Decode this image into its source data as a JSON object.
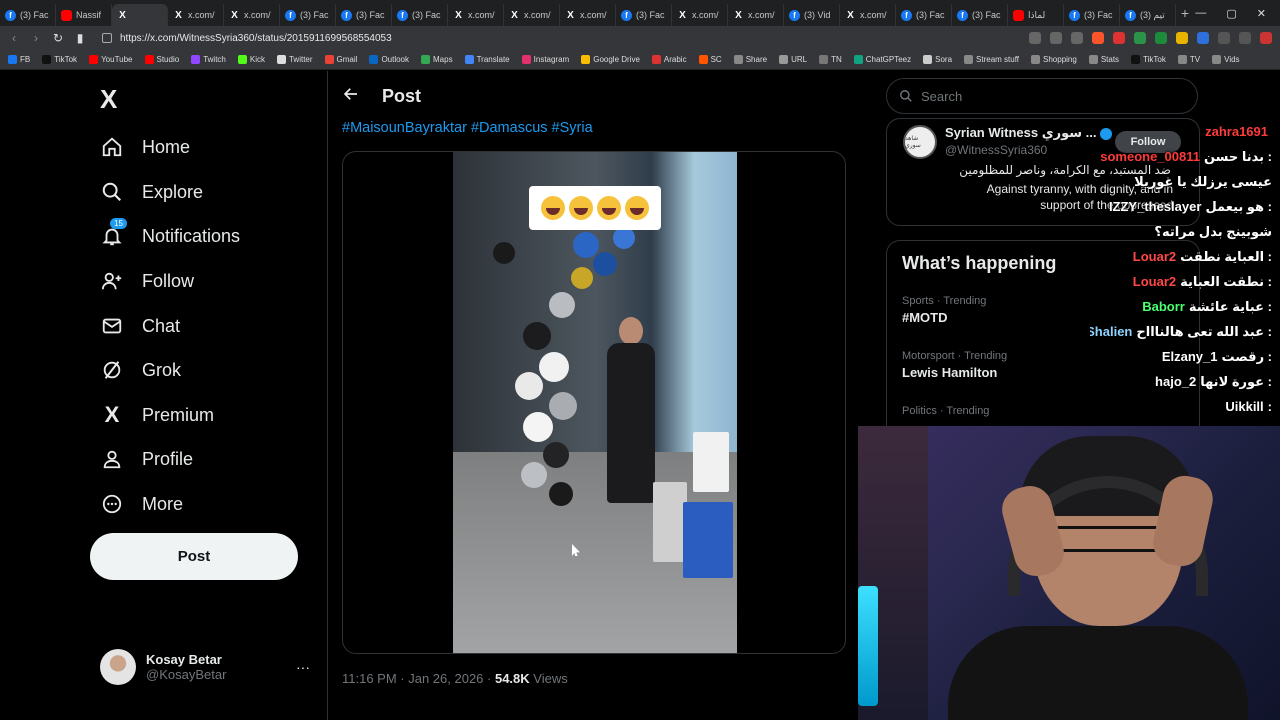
{
  "browser": {
    "tabs": [
      {
        "label": "(3) Fac",
        "icon": "facebook-icon",
        "active": false
      },
      {
        "label": "Nassif",
        "icon": "youtube-icon",
        "active": false
      },
      {
        "label": "",
        "icon": "x-icon",
        "active": true
      },
      {
        "label": "x.com/",
        "icon": "x-icon",
        "active": false
      },
      {
        "label": "x.com/",
        "icon": "x-icon",
        "active": false
      },
      {
        "label": "(3) Fac",
        "icon": "facebook-icon",
        "active": false
      },
      {
        "label": "(3) Fac",
        "icon": "facebook-icon",
        "active": false
      },
      {
        "label": "(3) Fac",
        "icon": "facebook-icon",
        "active": false
      },
      {
        "label": "x.com/",
        "icon": "x-icon",
        "active": false
      },
      {
        "label": "x.com/",
        "icon": "x-icon",
        "active": false
      },
      {
        "label": "x.com/",
        "icon": "x-icon",
        "active": false
      },
      {
        "label": "(3) Fac",
        "icon": "facebook-icon",
        "active": false
      },
      {
        "label": "x.com/",
        "icon": "x-icon",
        "active": false
      },
      {
        "label": "x.com/",
        "icon": "x-icon",
        "active": false
      },
      {
        "label": "(3) Vid",
        "icon": "facebook-icon",
        "active": false
      },
      {
        "label": "x.com/",
        "icon": "x-icon",
        "active": false
      },
      {
        "label": "(3) Fac",
        "icon": "facebook-icon",
        "active": false
      },
      {
        "label": "(3) Fac",
        "icon": "facebook-icon",
        "active": false
      },
      {
        "label": "لماذا",
        "icon": "youtube-icon",
        "active": false
      },
      {
        "label": "(3) Fac",
        "icon": "facebook-icon",
        "active": false
      },
      {
        "label": "(3) تيم",
        "icon": "facebook-icon",
        "active": false
      }
    ],
    "new_tab": "+",
    "url": "https://x.com/WitnessSyria360/status/2015911699568554053",
    "bookmarks": [
      "FB",
      "TikTok",
      "YouTube",
      "Studio",
      "Twitch",
      "Kick",
      "Twitter",
      "Gmail",
      "Outlook",
      "Maps",
      "Translate",
      "Instagram",
      "Google Drive",
      "Arabic",
      "SC",
      "Share",
      "URL",
      "TN",
      "ChatGPTeez",
      "Sora",
      "Stream stuff",
      "Shopping",
      "Stats",
      "TikTok",
      "TV",
      "Vids"
    ]
  },
  "nav": {
    "logo": "X",
    "items": [
      {
        "label": "Home",
        "icon": "home-icon"
      },
      {
        "label": "Explore",
        "icon": "search-icon"
      },
      {
        "label": "Notifications",
        "icon": "bell-icon",
        "badge": "15"
      },
      {
        "label": "Follow",
        "icon": "follow-icon"
      },
      {
        "label": "Chat",
        "icon": "mail-icon"
      },
      {
        "label": "Grok",
        "icon": "grok-icon"
      },
      {
        "label": "Premium",
        "icon": "x-premium-icon"
      },
      {
        "label": "Profile",
        "icon": "person-icon"
      },
      {
        "label": "More",
        "icon": "more-circle-icon"
      }
    ],
    "post_button": "Post",
    "account": {
      "name": "Kosay Betar",
      "handle": "@KosayBetar",
      "more": "···"
    }
  },
  "main": {
    "title": "Post",
    "hashtags": "#MaisounBayraktar #Damascus #Syria",
    "timestamp": "11:16 PM · Jan 26, 2026 · ",
    "views_count": "54.8K",
    "views_label": " Views"
  },
  "sidebar": {
    "search_placeholder": "Search",
    "profile": {
      "name": "Syrian Witness سوري ...",
      "handle": "@WitnessSyria360",
      "follow": "Follow",
      "bio_ar": "ضد المستبد، مع الكرامة، وناصر للمظلومين",
      "bio_en": "Against tyranny, with dignity, and in support of the oppressed"
    },
    "happening_title": "What’s happening",
    "trends": [
      {
        "category": "Sports · Trending",
        "name": "#MOTD"
      },
      {
        "category": "Motorsport · Trending",
        "name": "Lewis Hamilton"
      },
      {
        "category": "Politics · Trending",
        "name": ""
      }
    ]
  },
  "chat": {
    "messages": [
      {
        "user": "zahra1691",
        "text": "",
        "color": "#ff3b3b"
      },
      {
        "user": "someone_00811",
        "text": ": بدنا حسن",
        "color": "#ff3b3b"
      },
      {
        "user": "",
        "text": "عيسى يرزلك يا غوريلا",
        "color": "#ffffff"
      },
      {
        "user": "IZZY_theslayer",
        "text": ": هو بيعمل",
        "color": "#ffffff"
      },
      {
        "user": "",
        "text": "شوبينج بدل مراته؟",
        "color": "#ffffff"
      },
      {
        "user": "Louar2",
        "text": ": العباية نطقت",
        "color": "#ff4848"
      },
      {
        "user": "Louar2",
        "text": ": نطقت العباية",
        "color": "#ff4848"
      },
      {
        "user": "Baborr",
        "text": ": عباية عائشة",
        "color": "#4cff72"
      },
      {
        "user": "Shalien",
        "text": ": عبد الله تعى هالناااح",
        "color": "#8fd3ff"
      },
      {
        "user": "Elzany_1",
        "text": ": رقصت",
        "color": "#ffffff"
      },
      {
        "user": "hajo_2",
        "text": ": عورة لانها",
        "color": "#ffffff"
      },
      {
        "user": "Uikkill",
        "text": ":",
        "color": "#ffffff"
      }
    ]
  }
}
